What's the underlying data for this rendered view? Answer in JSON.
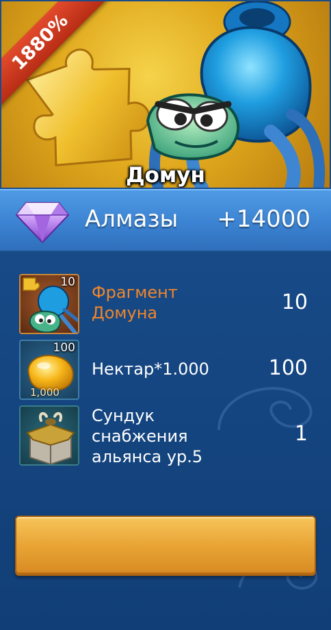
{
  "banner": {
    "discount_badge": "1880%",
    "hero_name": "Домун"
  },
  "header": {
    "currency_icon": "diamond-icon",
    "currency_name": "Алмазы",
    "currency_amount": "+14000"
  },
  "items": [
    {
      "icon": "hero-fragment-icon",
      "badge_count": "10",
      "name": "Фрагмент\nДомуна",
      "quantity": "10",
      "name_color": "#f0862a"
    },
    {
      "icon": "nectar-icon",
      "badge_count": "100",
      "icon_caption": "1,000",
      "name": "Нектар*1.000",
      "quantity": "100",
      "name_color": "#ffffff"
    },
    {
      "icon": "chest-icon",
      "name": "Сундук\nснабжения\nальянса ур.5",
      "quantity": "1",
      "name_color": "#ffffff"
    }
  ],
  "purchase_button": {
    "label": ""
  }
}
